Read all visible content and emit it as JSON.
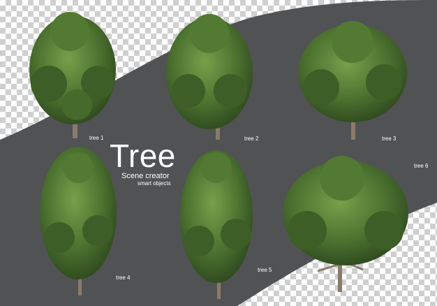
{
  "colors": {
    "road": "#505254",
    "checker_light": "#ffffff",
    "checker_dark": "#cfcfcf",
    "foliage_dark": "#2f4a1f",
    "foliage_mid": "#4a6e2e",
    "foliage_light": "#6f9644",
    "trunk": "#8a7a6a",
    "text": "#ffffff"
  },
  "title": {
    "main": "Tree",
    "subtitle": "Scene creator",
    "tagline": "smart objects"
  },
  "trees": [
    {
      "label": "tree 1"
    },
    {
      "label": "tree 2"
    },
    {
      "label": "tree 3"
    },
    {
      "label": "tree 4"
    },
    {
      "label": "tree 5"
    },
    {
      "label": "tree 6"
    }
  ]
}
